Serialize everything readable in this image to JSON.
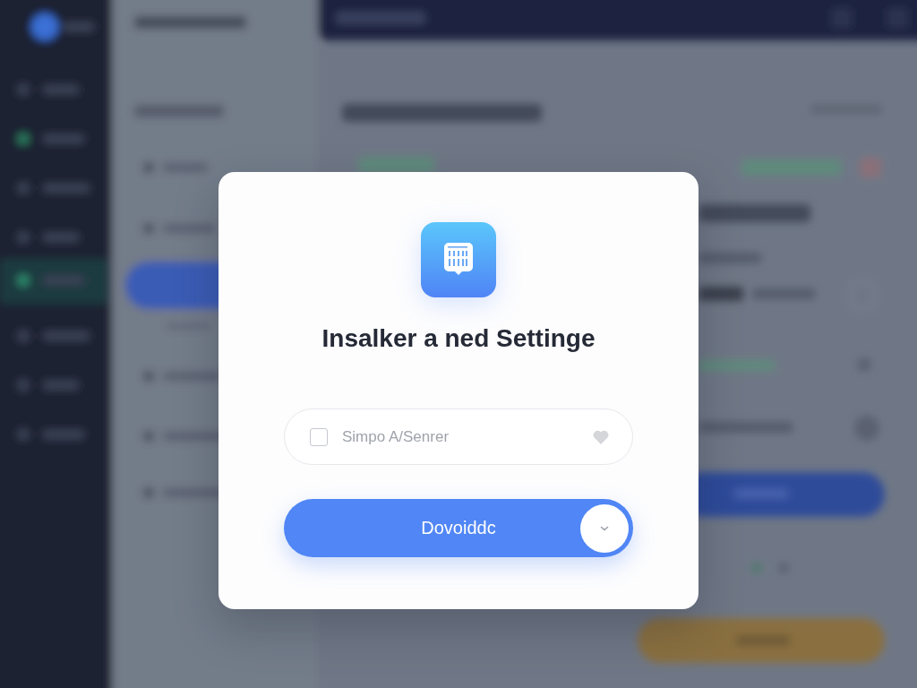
{
  "dialog": {
    "title": "Insalker a ned Settinge",
    "field": {
      "checked": false,
      "placeholder": "Simpo A/Senrer"
    },
    "button": {
      "label": "Dovoiddc"
    }
  }
}
